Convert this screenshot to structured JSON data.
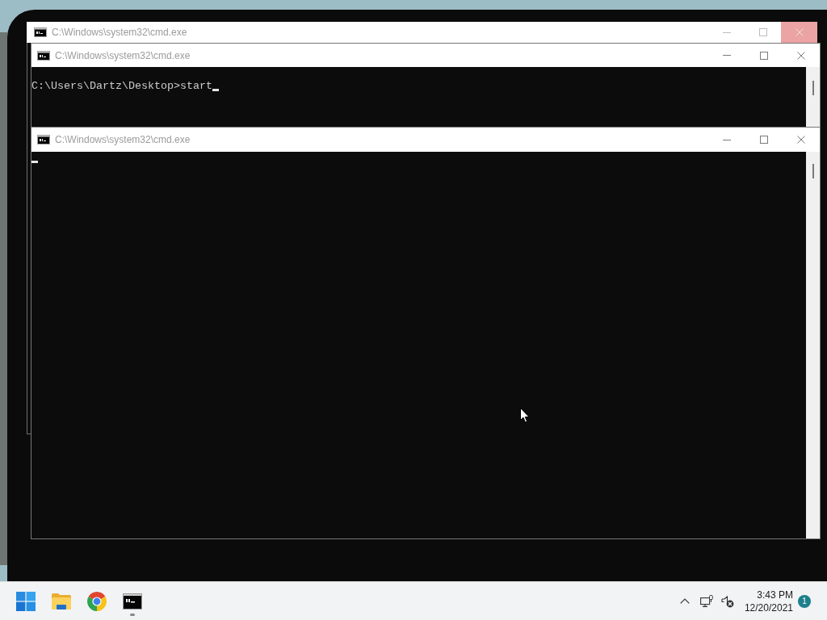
{
  "windows": [
    {
      "title": "C:\\Windows\\system32\\cmd.exe",
      "close_hovered": true
    },
    {
      "title": "C:\\Windows\\system32\\cmd.exe",
      "close_hovered": false,
      "lines": [
        "C:\\Users\\Dartz\\Desktop>start"
      ],
      "cursor": true
    },
    {
      "title": "C:\\Windows\\system32\\cmd.exe",
      "close_hovered": false,
      "cursor": true
    }
  ],
  "taskbar": {
    "apps": [
      {
        "kind": "start",
        "running": false
      },
      {
        "kind": "explorer",
        "running": false
      },
      {
        "kind": "browser",
        "running": false
      },
      {
        "kind": "terminal",
        "running": true
      }
    ],
    "clock": {
      "time": "3:43 PM",
      "date": "12/20/2021"
    },
    "notification_count": "1"
  }
}
